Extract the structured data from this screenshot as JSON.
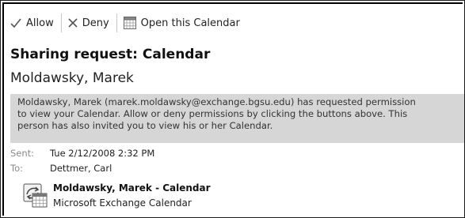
{
  "toolbar": {
    "allow_label": "Allow",
    "deny_label": "Deny",
    "open_calendar_label": "Open this Calendar"
  },
  "message": {
    "title": "Sharing request: Calendar",
    "sender": "Moldawsky, Marek",
    "info_lines": [
      "Moldawsky, Marek (marek.moldawsky@exchange.bgsu.edu) has requested permission",
      "to view your Calendar. Allow or deny permissions by clicking the buttons above. This",
      "person has also invited you to view his or her Calendar."
    ],
    "sent_label": "Sent:",
    "sent_value": "Tue 2/12/2008 2:32 PM",
    "to_label": "To:",
    "to_value": "Dettmer, Carl"
  },
  "attachment": {
    "name": "Moldawsky, Marek - Calendar",
    "type": "Microsoft Exchange Calendar"
  }
}
